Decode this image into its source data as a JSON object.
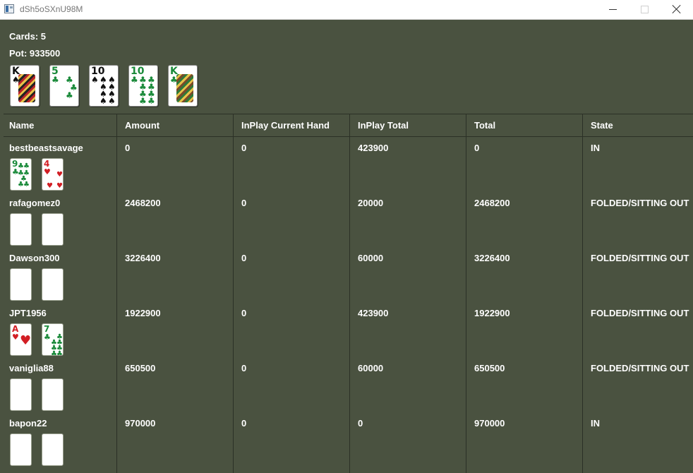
{
  "window": {
    "title": "dSh5oSXnU98M"
  },
  "board": {
    "cards_label": "Cards: 5",
    "pot_label": "Pot: 933500",
    "cards": [
      {
        "rank": "K",
        "suit": "♠",
        "color": "blk",
        "face": true
      },
      {
        "rank": "5",
        "suit": "♣",
        "color": "grn",
        "face": false
      },
      {
        "rank": "10",
        "suit": "♠",
        "color": "blk",
        "face": false
      },
      {
        "rank": "10",
        "suit": "♣",
        "color": "grn",
        "face": false
      },
      {
        "rank": "K",
        "suit": "♣",
        "color": "grn",
        "face": true
      }
    ]
  },
  "table": {
    "columns": [
      "Name",
      "Amount",
      "InPlay Current Hand",
      "InPlay Total",
      "Total",
      "State"
    ],
    "rows": [
      {
        "name": "bestbeastsavage",
        "amount": "0",
        "inplay_current": "0",
        "inplay_total": "423900",
        "total": "0",
        "state": "IN",
        "cards": [
          {
            "rank": "9",
            "suit": "♣",
            "color": "grn",
            "shown": true
          },
          {
            "rank": "4",
            "suit": "♥",
            "color": "red",
            "shown": true
          }
        ]
      },
      {
        "name": "rafagomez0",
        "amount": "2468200",
        "inplay_current": "0",
        "inplay_total": "20000",
        "total": "2468200",
        "state": "FOLDED/SITTING OUT",
        "cards": [
          {
            "shown": false
          },
          {
            "shown": false
          }
        ]
      },
      {
        "name": "Dawson300",
        "amount": "3226400",
        "inplay_current": "0",
        "inplay_total": "60000",
        "total": "3226400",
        "state": "FOLDED/SITTING OUT",
        "cards": [
          {
            "shown": false
          },
          {
            "shown": false
          }
        ]
      },
      {
        "name": "JPT1956",
        "amount": "1922900",
        "inplay_current": "0",
        "inplay_total": "423900",
        "total": "1922900",
        "state": "FOLDED/SITTING OUT",
        "cards": [
          {
            "rank": "A",
            "suit": "♥",
            "color": "red",
            "shown": true
          },
          {
            "rank": "7",
            "suit": "♣",
            "color": "grn",
            "shown": true
          }
        ]
      },
      {
        "name": "vaniglia88",
        "amount": "650500",
        "inplay_current": "0",
        "inplay_total": "60000",
        "total": "650500",
        "state": "FOLDED/SITTING OUT",
        "cards": [
          {
            "shown": false
          },
          {
            "shown": false
          }
        ]
      },
      {
        "name": "bapon22",
        "amount": "970000",
        "inplay_current": "0",
        "inplay_total": "0",
        "total": "970000",
        "state": "IN",
        "cards": [
          {
            "shown": false
          },
          {
            "shown": false
          }
        ]
      }
    ]
  },
  "colors": {
    "background": "#4a5240",
    "grid": "#2b3026",
    "red_suit": "#d21e24",
    "club_suit": "#1a8a3a",
    "spade_suit": "#111111"
  }
}
